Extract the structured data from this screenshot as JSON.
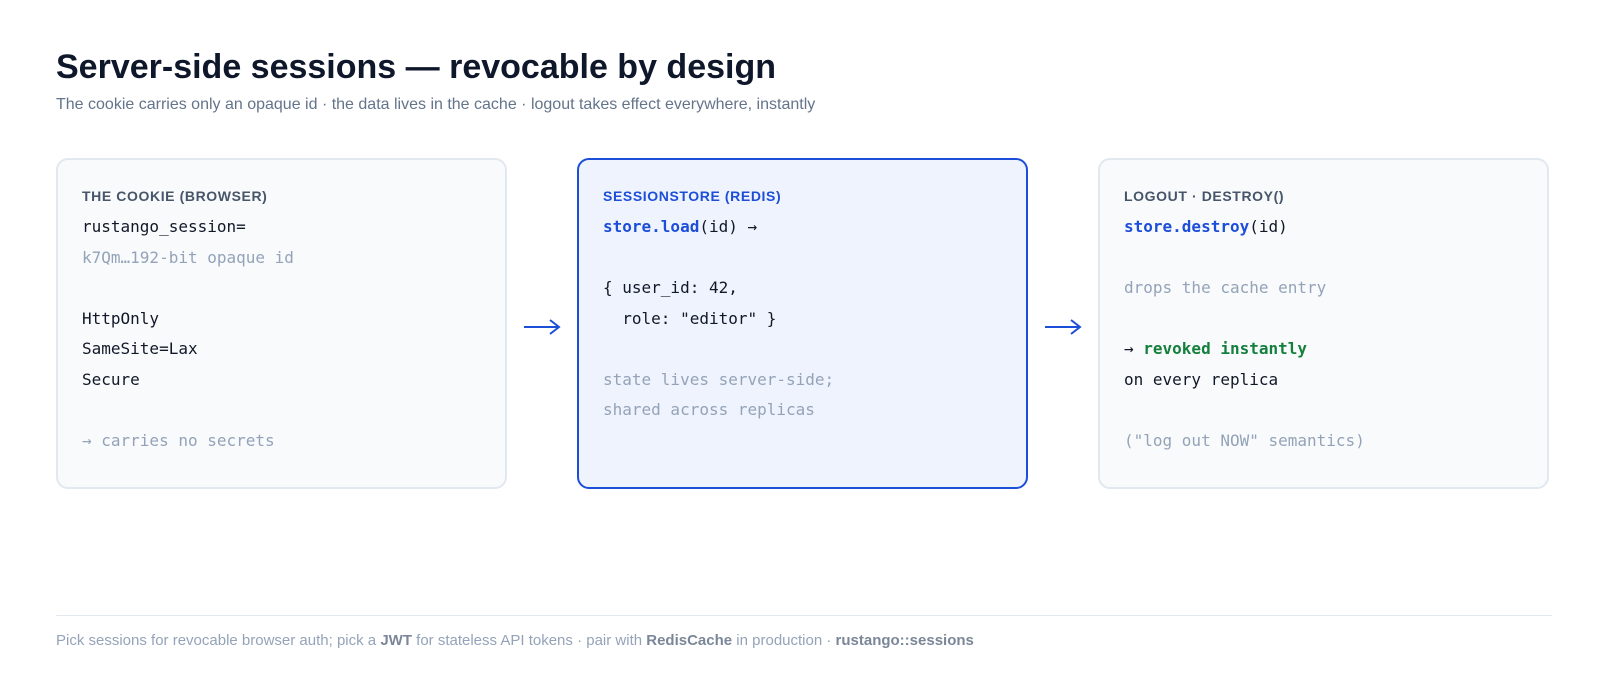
{
  "header": {
    "title": "Server-side sessions — revocable by design",
    "subtitle": "The cookie carries only an opaque id · the data lives in the cache · logout takes effect everywhere, instantly"
  },
  "cards": {
    "cookie": {
      "title": "THE COOKIE (BROWSER)",
      "line1": "rustango_session=",
      "line2": "k7Qm…192-bit opaque id",
      "line3": "HttpOnly",
      "line4": "SameSite=Lax",
      "line5": "Secure",
      "line6": "→ carries no secrets"
    },
    "store": {
      "title": "SESSIONSTORE (REDIS)",
      "line1_fn": "store.load",
      "line1_rest": "(id) →",
      "line2": "{ user_id: 42,",
      "line3": "  role: \"editor\" }",
      "line4": "state lives server-side;",
      "line5": "shared across replicas"
    },
    "logout": {
      "title": "LOGOUT · DESTROY()",
      "line1_fn": "store.destroy",
      "line1_rest": "(id)",
      "line2": "drops the cache entry",
      "line3_arrow": "→ ",
      "line3_ok": "revoked instantly",
      "line4": "on every replica",
      "line5": "(\"log out NOW\" semantics)"
    }
  },
  "footer": {
    "part1": "Pick sessions for revocable browser auth; pick a ",
    "jwt": "JWT",
    "part2": " for stateless API tokens · pair with ",
    "redis": "RedisCache",
    "part3": " in production · ",
    "module": "rustango::sessions"
  },
  "colors": {
    "accent": "#1d4ed8",
    "success": "#15803d",
    "muted": "#94a3b8",
    "border": "#e2e8f0"
  },
  "icons": [
    "arrow-right-icon",
    "arrow-right-icon"
  ]
}
